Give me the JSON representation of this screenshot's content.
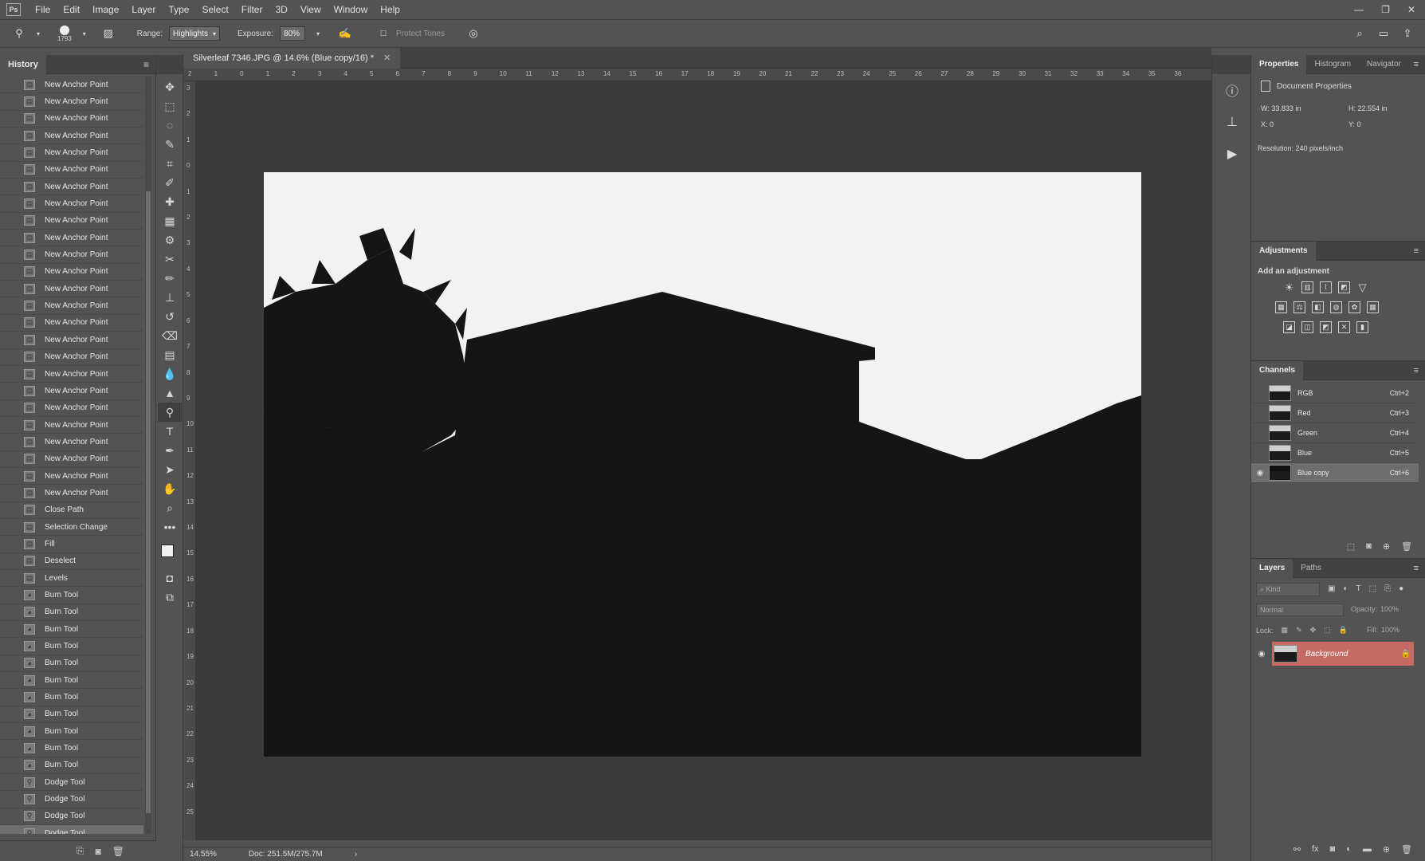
{
  "app": {
    "logo": "Ps"
  },
  "menu": [
    "File",
    "Edit",
    "Image",
    "Layer",
    "Type",
    "Select",
    "Filter",
    "3D",
    "View",
    "Window",
    "Help"
  ],
  "options": {
    "brush_size": "1793",
    "range_label": "Range:",
    "range_value": "Highlights",
    "exposure_label": "Exposure:",
    "exposure_value": "80%",
    "protect_tones": "Protect Tones"
  },
  "history": {
    "title": "History",
    "items": [
      {
        "label": "New Anchor Point",
        "icon": "doc"
      },
      {
        "label": "New Anchor Point",
        "icon": "doc"
      },
      {
        "label": "New Anchor Point",
        "icon": "doc"
      },
      {
        "label": "New Anchor Point",
        "icon": "doc"
      },
      {
        "label": "New Anchor Point",
        "icon": "doc"
      },
      {
        "label": "New Anchor Point",
        "icon": "doc"
      },
      {
        "label": "New Anchor Point",
        "icon": "doc"
      },
      {
        "label": "New Anchor Point",
        "icon": "doc"
      },
      {
        "label": "New Anchor Point",
        "icon": "doc"
      },
      {
        "label": "New Anchor Point",
        "icon": "doc"
      },
      {
        "label": "New Anchor Point",
        "icon": "doc"
      },
      {
        "label": "New Anchor Point",
        "icon": "doc"
      },
      {
        "label": "New Anchor Point",
        "icon": "doc"
      },
      {
        "label": "New Anchor Point",
        "icon": "doc"
      },
      {
        "label": "New Anchor Point",
        "icon": "doc"
      },
      {
        "label": "New Anchor Point",
        "icon": "doc"
      },
      {
        "label": "New Anchor Point",
        "icon": "doc"
      },
      {
        "label": "New Anchor Point",
        "icon": "doc"
      },
      {
        "label": "New Anchor Point",
        "icon": "doc"
      },
      {
        "label": "New Anchor Point",
        "icon": "doc"
      },
      {
        "label": "New Anchor Point",
        "icon": "doc"
      },
      {
        "label": "New Anchor Point",
        "icon": "doc"
      },
      {
        "label": "New Anchor Point",
        "icon": "doc"
      },
      {
        "label": "New Anchor Point",
        "icon": "doc"
      },
      {
        "label": "New Anchor Point",
        "icon": "doc"
      },
      {
        "label": "Close Path",
        "icon": "doc"
      },
      {
        "label": "Selection Change",
        "icon": "doc"
      },
      {
        "label": "Fill",
        "icon": "doc"
      },
      {
        "label": "Deselect",
        "icon": "doc"
      },
      {
        "label": "Levels",
        "icon": "doc"
      },
      {
        "label": "Burn Tool",
        "icon": "burn"
      },
      {
        "label": "Burn Tool",
        "icon": "burn"
      },
      {
        "label": "Burn Tool",
        "icon": "burn"
      },
      {
        "label": "Burn Tool",
        "icon": "burn"
      },
      {
        "label": "Burn Tool",
        "icon": "burn"
      },
      {
        "label": "Burn Tool",
        "icon": "burn"
      },
      {
        "label": "Burn Tool",
        "icon": "burn"
      },
      {
        "label": "Burn Tool",
        "icon": "burn"
      },
      {
        "label": "Burn Tool",
        "icon": "burn"
      },
      {
        "label": "Burn Tool",
        "icon": "burn"
      },
      {
        "label": "Burn Tool",
        "icon": "burn"
      },
      {
        "label": "Dodge Tool",
        "icon": "dodge"
      },
      {
        "label": "Dodge Tool",
        "icon": "dodge"
      },
      {
        "label": "Dodge Tool",
        "icon": "dodge"
      },
      {
        "label": "Dodge Tool",
        "icon": "dodge"
      }
    ]
  },
  "document": {
    "tab_title": "Silverleaf 7346.JPG @ 14.6% (Blue copy/16) *",
    "zoom": "14.55%",
    "doc_size": "Doc: 251.5M/275.7M",
    "ruler_top": [
      "2",
      "1",
      "0",
      "1",
      "2",
      "3",
      "4",
      "5",
      "6",
      "7",
      "8",
      "9",
      "10",
      "11",
      "12",
      "13",
      "14",
      "15",
      "16",
      "17",
      "18",
      "19",
      "20",
      "21",
      "22",
      "23",
      "24",
      "25",
      "26",
      "27",
      "28",
      "29",
      "30",
      "31",
      "32",
      "33",
      "34",
      "35",
      "36"
    ],
    "ruler_left": [
      "3",
      "2",
      "1",
      "0",
      "1",
      "2",
      "3",
      "4",
      "5",
      "6",
      "7",
      "8",
      "9",
      "10",
      "11",
      "12",
      "13",
      "14",
      "15",
      "16",
      "17",
      "18",
      "19",
      "20",
      "21",
      "22",
      "23",
      "24",
      "25"
    ]
  },
  "properties": {
    "tabs": [
      "Properties",
      "Histogram",
      "Navigator"
    ],
    "section": "Document Properties",
    "w_label": "W:",
    "w_value": "33.833 in",
    "h_label": "H:",
    "h_value": "22.554 in",
    "x_label": "X:",
    "x_value": "0",
    "y_label": "Y:",
    "y_value": "0",
    "resolution": "Resolution: 240 pixels/inch"
  },
  "adjustments": {
    "title": "Adjustments",
    "subtitle": "Add an adjustment"
  },
  "channels": {
    "title": "Channels",
    "rows": [
      {
        "name": "RGB",
        "key": "Ctrl+2"
      },
      {
        "name": "Red",
        "key": "Ctrl+3"
      },
      {
        "name": "Green",
        "key": "Ctrl+4"
      },
      {
        "name": "Blue",
        "key": "Ctrl+5"
      },
      {
        "name": "Blue copy",
        "key": "Ctrl+6"
      }
    ]
  },
  "layers": {
    "tabs": [
      "Layers",
      "Paths"
    ],
    "kind_placeholder": "Kind",
    "blend_mode": "Normal",
    "opacity_label": "Opacity:",
    "opacity_value": "100%",
    "lock_label": "Lock:",
    "fill_label": "Fill:",
    "fill_value": "100%",
    "layer_name": "Background"
  }
}
